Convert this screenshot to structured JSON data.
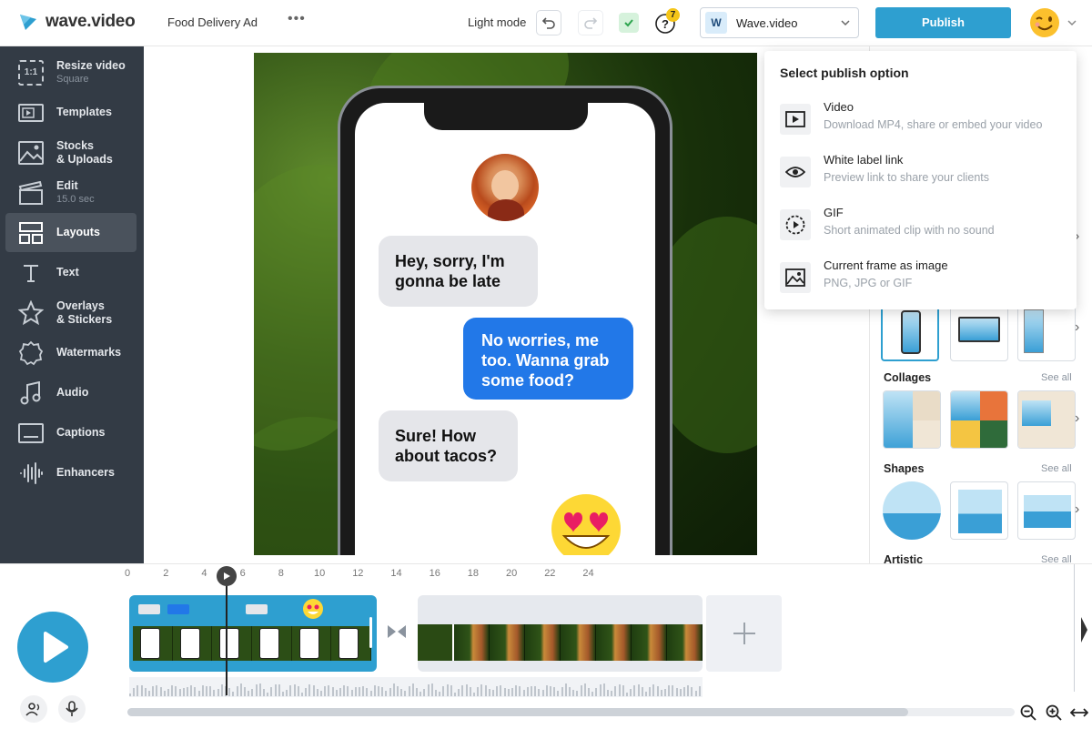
{
  "topbar": {
    "logo_text": "wave.video",
    "project_name": "Food Delivery Ad",
    "more_label": "•••",
    "light_mode_label": "Light mode",
    "help_badge": "7",
    "workspace_letter": "W",
    "workspace_name": "Wave.video",
    "publish_label": "Publish"
  },
  "sidebar": {
    "items": [
      {
        "label": "Resize video",
        "sub": "Square",
        "icon": "resize-icon"
      },
      {
        "label": "Templates",
        "sub": "",
        "icon": "templates-icon"
      },
      {
        "label": "Stocks",
        "label2": "& Uploads",
        "icon": "stocks-icon"
      },
      {
        "label": "Edit",
        "sub": "15.0 sec",
        "icon": "clapper-icon"
      },
      {
        "label": "Layouts",
        "sub": "",
        "icon": "layouts-icon",
        "active": true
      },
      {
        "label": "Text",
        "sub": "",
        "icon": "text-icon"
      },
      {
        "label": "Overlays",
        "label2": "& Stickers",
        "icon": "star-icon"
      },
      {
        "label": "Watermarks",
        "sub": "",
        "icon": "watermark-icon"
      },
      {
        "label": "Audio",
        "sub": "",
        "icon": "music-icon"
      },
      {
        "label": "Captions",
        "sub": "",
        "icon": "captions-icon"
      },
      {
        "label": "Enhancers",
        "sub": "",
        "icon": "waveform-icon"
      }
    ],
    "resize_icon_text": "1:1"
  },
  "canvas": {
    "msg1": "Hey, sorry, I'm gonna be late",
    "msg2": "No worries, me too. Wanna grab some food?",
    "msg3": "Sure! How about tacos?",
    "sticker": "heart-eyes-emoji"
  },
  "publish_popup": {
    "title": "Select publish option",
    "options": [
      {
        "label": "Video",
        "desc": "Download MP4, share or embed your video",
        "icon": "play-box-icon"
      },
      {
        "label": "White label link",
        "desc": "Preview link to share your clients",
        "icon": "eye-icon"
      },
      {
        "label": "GIF",
        "desc": "Short animated clip with no sound",
        "icon": "gif-play-icon"
      },
      {
        "label": "Current frame as image",
        "desc": "PNG, JPG or GIF",
        "icon": "image-icon"
      }
    ]
  },
  "right_panel": {
    "sections": [
      {
        "title": "Collages",
        "see_all": "See all"
      },
      {
        "title": "Shapes",
        "see_all": "See all"
      },
      {
        "title": "Artistic",
        "see_all": "See all"
      }
    ]
  },
  "timeline": {
    "ticks": [
      "0",
      "2",
      "4",
      "6",
      "8",
      "10",
      "12",
      "14",
      "16",
      "18",
      "20",
      "22",
      "24"
    ],
    "playhead_seconds": 5.1,
    "scroll_position": 0.88
  },
  "colors": {
    "accent": "#2e9fd0",
    "sidebar_bg": "#333b45",
    "bubble_blue": "#2278e8",
    "bubble_gray": "#e5e6ea"
  }
}
